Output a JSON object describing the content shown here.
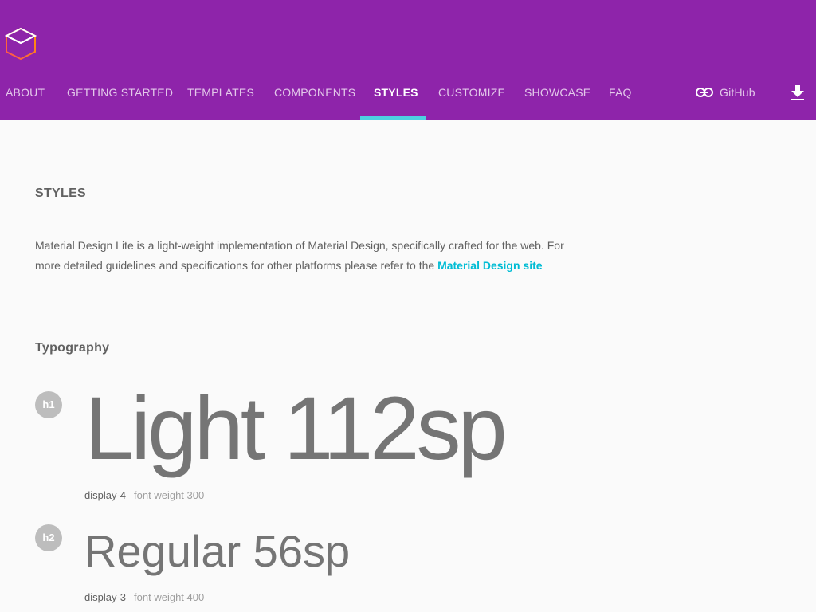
{
  "header": {
    "logo_icon": "cube-logo-icon",
    "nav": [
      {
        "label": "ABOUT"
      },
      {
        "label": "GETTING STARTED"
      },
      {
        "label": "TEMPLATES"
      },
      {
        "label": "COMPONENTS"
      },
      {
        "label": "STYLES",
        "active": true
      },
      {
        "label": "CUSTOMIZE"
      },
      {
        "label": "SHOWCASE"
      },
      {
        "label": "FAQ"
      }
    ],
    "github_label": "GitHub",
    "github_icon": "link-icon",
    "download_icon": "download-icon",
    "colors": {
      "bar": "#8e24aa",
      "active_indicator": "#4dd0e1"
    }
  },
  "main": {
    "title": "STYLES",
    "intro_text": "Material Design Lite is a light-weight implementation of Material Design, specifically crafted for the web. For more detailed guidelines and specifications for other platforms please refer to the ",
    "intro_link": "Material Design site",
    "link_color": "#00bcd4",
    "typography_title": "Typography",
    "samples": [
      {
        "badge": "h1",
        "text": "Light 112sp",
        "style_name": "display-4",
        "weight": "font weight 300"
      },
      {
        "badge": "h2",
        "text": "Regular 56sp",
        "style_name": "display-3",
        "weight": "font weight 400"
      }
    ]
  }
}
